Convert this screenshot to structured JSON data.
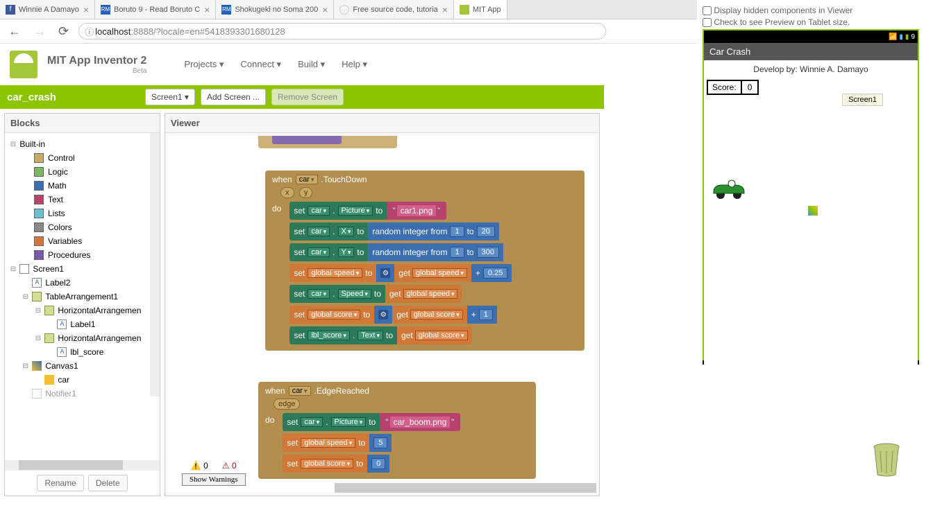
{
  "browser": {
    "tabs": [
      {
        "title": "Winnie A Damayo",
        "fav": "fb"
      },
      {
        "title": "Boruto 9 - Read Boruto C",
        "fav": "rm"
      },
      {
        "title": "Shokugeki no Soma 200",
        "fav": "rm"
      },
      {
        "title": "Free source code, tutoria",
        "fav": "g"
      },
      {
        "title": "MIT App",
        "fav": "ai",
        "active": true
      }
    ],
    "url_info": "ⓘ",
    "url_host": "localhost",
    "url_rest": ":8888/?locale=en#5418393301680128"
  },
  "app": {
    "title": "MIT App Inventor 2",
    "beta": "Beta",
    "menus": [
      "Projects ▾",
      "Connect ▾",
      "Build ▾",
      "Help ▾"
    ]
  },
  "toolbar": {
    "project": "car_crash",
    "screen_btn": "Screen1 ▾",
    "add_screen": "Add Screen ...",
    "remove_screen": "Remove Screen"
  },
  "left_panel": {
    "header": "Blocks",
    "builtin": "Built-in",
    "builtin_items": [
      {
        "label": "Control",
        "color": "#c9a968"
      },
      {
        "label": "Logic",
        "color": "#7bb661"
      },
      {
        "label": "Math",
        "color": "#3c6fb0"
      },
      {
        "label": "Text",
        "color": "#b8416c"
      },
      {
        "label": "Lists",
        "color": "#6cc0d0"
      },
      {
        "label": "Colors",
        "color": "#888888"
      },
      {
        "label": "Variables",
        "color": "#d07838"
      },
      {
        "label": "Procedures",
        "color": "#7a5aa8"
      }
    ],
    "components": [
      {
        "label": "Screen1",
        "indent": 0,
        "toggle": "⊟",
        "icon": "screen"
      },
      {
        "label": "Label2",
        "indent": 1,
        "icon": "A"
      },
      {
        "label": "TableArrangement1",
        "indent": 1,
        "toggle": "⊟",
        "icon": "table"
      },
      {
        "label": "HorizontalArrangemen",
        "indent": 2,
        "toggle": "⊟",
        "icon": "h"
      },
      {
        "label": "Label1",
        "indent": 3,
        "icon": "A"
      },
      {
        "label": "HorizontalArrangemen",
        "indent": 2,
        "toggle": "⊟",
        "icon": "h"
      },
      {
        "label": "lbl_score",
        "indent": 3,
        "icon": "A"
      },
      {
        "label": "Canvas1",
        "indent": 1,
        "toggle": "⊟",
        "icon": "canvas"
      },
      {
        "label": "car",
        "indent": 2,
        "icon": "sprite"
      },
      {
        "label": "Notifier1",
        "indent": 1,
        "icon": "n",
        "cut": true
      }
    ],
    "rename": "Rename",
    "delete": "Delete"
  },
  "viewer_header": "Viewer",
  "blocks": {
    "event1": {
      "when": "when",
      "subj": "car",
      "evt": ".TouchDown",
      "params": [
        "x",
        "y"
      ],
      "do": "do",
      "rows": [
        {
          "type": "set_text",
          "set": "set",
          "s1": "car",
          "s2": "Picture",
          "to": "to",
          "val": "car1.png"
        },
        {
          "type": "set_rand",
          "set": "set",
          "s1": "car",
          "s2": "X",
          "to": "to",
          "rand": "random integer from",
          "n1": "1",
          "tolbl": "to",
          "n2": "20"
        },
        {
          "type": "set_rand",
          "set": "set",
          "s1": "car",
          "s2": "Y",
          "to": "to",
          "rand": "random integer from",
          "n1": "1",
          "tolbl": "to",
          "n2": "300"
        },
        {
          "type": "set_global_math",
          "set": "set",
          "g": "global speed",
          "to": "to",
          "get": "get",
          "gv": "global speed",
          "op": "+",
          "num": "0.25"
        },
        {
          "type": "set_get",
          "set": "set",
          "s1": "car",
          "s2": "Speed",
          "to": "to",
          "get": "get",
          "gv": "global speed"
        },
        {
          "type": "set_global_math",
          "set": "set",
          "g": "global score",
          "to": "to",
          "get": "get",
          "gv": "global score",
          "op": "+",
          "num": "1"
        },
        {
          "type": "set_get_green",
          "set": "set",
          "s1": "lbl_score",
          "s2": "Text",
          "to": "to",
          "get": "get",
          "gv": "global score"
        }
      ]
    },
    "event2": {
      "when": "when",
      "subj": "car",
      "evt": ".EdgeReached",
      "params": [
        "edge"
      ],
      "do": "do",
      "rows": [
        {
          "type": "set_text",
          "set": "set",
          "s1": "car",
          "s2": "Picture",
          "to": "to",
          "val": "car_boom.png"
        },
        {
          "type": "set_global_num",
          "set": "set",
          "g": "global speed",
          "to": "to",
          "num": "5"
        },
        {
          "type": "set_global_num",
          "set": "set",
          "g": "global score",
          "to": "to",
          "num": "0"
        }
      ]
    }
  },
  "warnings": {
    "yellow": "0",
    "red": "0",
    "show": "Show Warnings"
  },
  "preview": {
    "chk1": "Display hidden components in Viewer",
    "chk2": "Check to see Preview on Tablet size.",
    "time": "9",
    "app_title": "Car Crash",
    "dev_by": "Develop by: Winnie A. Damayo",
    "score_lbl": "Score:",
    "score_val": "0",
    "screen1": "Screen1"
  }
}
